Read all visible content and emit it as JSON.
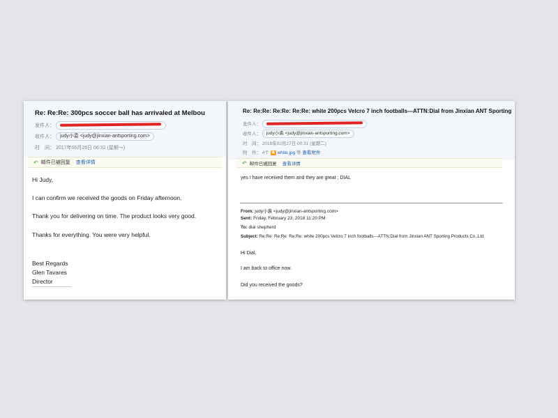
{
  "left": {
    "subject": "Re: Re:Re: 300pcs soccer ball has arrivaled at Melbou",
    "from_label": "发件人：",
    "to_label": "收件人：",
    "to_value": "judy小袁 <judy@jinxian-antsporting.com>",
    "time_label": "时　间：",
    "time_value": "2017年06月26日 06:32 (星期一)",
    "toolbar_replied": "邮件已被回复",
    "toolbar_detail": "查看详情",
    "body": {
      "greeting": "Hi Judy,",
      "line1": "I can confirm we received the goods on Friday afternoon.",
      "line2": "Thank you for delivering on time. The product looks very good.",
      "line3": "Thanks for everything. You were very helpful.",
      "regards": "Best Regards",
      "name": "Glen Tavares",
      "title": "Director"
    }
  },
  "right": {
    "subject": "Re: Re:Re: Re:Re: Re:Re: white 200pcs Velcro 7 inch footballs---ATTN:Dial from Jinxian ANT Sporting",
    "from_label": "发件人：",
    "to_label": "收件人：",
    "to_value": "judy小袁 <judy@jinxian-antsporting.com>",
    "time_label": "时　间：",
    "time_value": "2018年02月27日 00:31 (星期二)",
    "attach_label": "附　件：",
    "attach_count": "4个",
    "attach_file": "white.jpg",
    "attach_more": "等",
    "attach_view": "查看附件",
    "toolbar_replied": "邮件已被回复",
    "toolbar_detail": "查看详情",
    "reply_line": "yes I have received them and they are  great ; DIAL",
    "quoted": {
      "from_label": "From:",
      "from_value": "judy小袁 <judy@jinxian-antsporting.com>",
      "sent_label": "Sent:",
      "sent_value": "Friday, February 23, 2018 11:20 PM",
      "to_label": "To:",
      "to_value": "dial shepherd",
      "subject_label": "Subject:",
      "subject_value": "Re:Re: Re:Re: Re:Re: white 200pcs Velcro 7 inch footballs---ATTN:Dial from Jinxian ANT Sporting Products Co.,Ltd",
      "greeting": "Hi Dial,",
      "line1": "I am back to office now.",
      "line2": "Did you received the goods?"
    }
  }
}
